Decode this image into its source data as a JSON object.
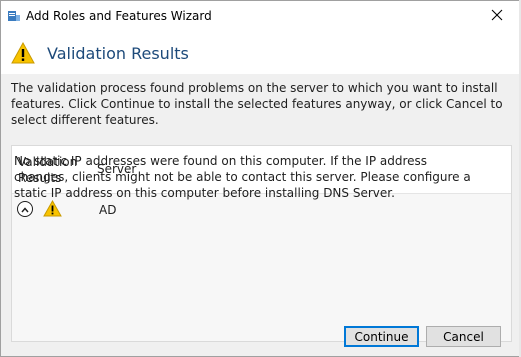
{
  "window": {
    "title": "Add Roles and Features Wizard",
    "app_icon": "server-manager-icon",
    "close_icon": "close-icon"
  },
  "header": {
    "icon": "warning-icon",
    "title": "Validation Results"
  },
  "description": "The validation process found problems on the server to which you want to install features. Click Continue to install the selected features anyway, or click Cancel to select different features.",
  "results": {
    "columns": {
      "validation_results": "Validation Results",
      "server": "Server"
    },
    "rows": [
      {
        "expanded": true,
        "status_icon": "warning-icon",
        "server": "AD",
        "detail": "No static IP addresses were found on this computer. If the IP address changes, clients might not be able to contact this server. Please configure a static IP address on this computer before installing DNS Server."
      }
    ]
  },
  "buttons": {
    "continue": "Continue",
    "cancel": "Cancel"
  },
  "colors": {
    "header_title": "#1d4a7a",
    "warning_fill": "#f8c300",
    "default_button_border": "#0078d7"
  }
}
